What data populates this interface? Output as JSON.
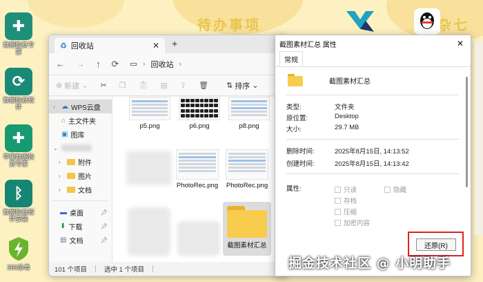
{
  "wallpaper": {
    "todo_text": "待办事项",
    "misc_text": "杂七杂",
    "colors": {
      "bg": "#fdf1c2",
      "text": "#e8c64f"
    }
  },
  "desktop_icons": [
    {
      "label": "数据恢复专家",
      "icon": "plus-cross-icon",
      "color": "#1f8f7a"
    },
    {
      "label": "数据恢复软件",
      "icon": "recovery-circle-icon",
      "color": "#1a8a78"
    },
    {
      "label": "苹果数据恢复专家",
      "icon": "plus-cross-icon",
      "color": "#179a70"
    },
    {
      "label": "数据恢复软件安装",
      "icon": "bluetooth-like-icon",
      "color": "#168574"
    },
    {
      "label": "360杀毒",
      "icon": "shield-bolt-icon",
      "color": "#6ab42d"
    }
  ],
  "explorer": {
    "tab_title": "回收站",
    "breadcrumb": "回收站",
    "toolbar": {
      "new_label": "新建",
      "sort_label": "排序"
    },
    "nav": {
      "items": [
        {
          "label": "WPS云盘",
          "icon": "cloud-icon",
          "selected": true
        },
        {
          "label": "主文件夹",
          "icon": "home-icon"
        },
        {
          "label": "图库",
          "icon": "gallery-icon"
        }
      ],
      "folders": [
        {
          "label": "附件",
          "icon": "folder-icon"
        },
        {
          "label": "图片",
          "icon": "folder-icon"
        },
        {
          "label": "文档",
          "icon": "folder-icon"
        }
      ],
      "pinned": [
        {
          "label": "桌面",
          "icon": "desktop-icon"
        },
        {
          "label": "下载",
          "icon": "download-icon"
        },
        {
          "label": "文档",
          "icon": "document-icon"
        }
      ]
    },
    "files": [
      {
        "name": "p5.png"
      },
      {
        "name": "p6.png"
      },
      {
        "name": "p8.png"
      },
      {
        "name": "PhotoRec.png"
      },
      {
        "name": "PhotoRec.png"
      },
      {
        "name": "截图素材汇总"
      }
    ],
    "status": {
      "count": "101 个项目",
      "selected": "选中 1 个项目"
    }
  },
  "properties_dialog": {
    "title": "截图素材汇总 属性",
    "tab": "常规",
    "name": "截图素材汇总",
    "rows": [
      {
        "key": "类型:",
        "value": "文件夹"
      },
      {
        "key": "原位置:",
        "value": "Desktop"
      },
      {
        "key": "大小:",
        "value": "29.7 MB"
      },
      {
        "key": "删除时间:",
        "value": "2025年8月15日, 14:13:52"
      },
      {
        "key": "创建时间:",
        "value": "2025年8月15日, 14:13:42"
      }
    ],
    "attributes_label": "属性:",
    "checkboxes": {
      "readonly": "只读",
      "hidden": "隐藏",
      "archive": "存档",
      "compress": "压缩",
      "encrypt": "加密内容"
    },
    "restore_button": "还原(R)",
    "highlight_color": "#e01f1f"
  },
  "watermark": "掘金技术社区 @ 小明助手"
}
